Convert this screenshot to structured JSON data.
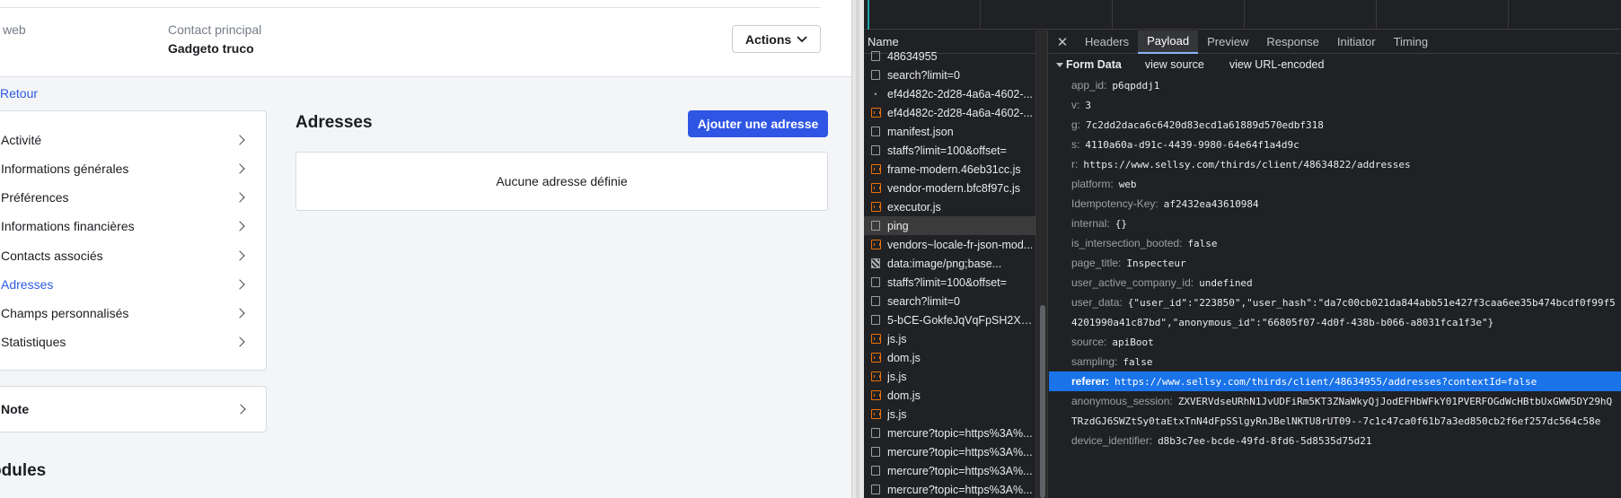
{
  "app": {
    "header": {
      "web_label": "web",
      "contact_label": "Contact principal",
      "contact_value": "Gadgeto truco",
      "actions_label": "Actions"
    },
    "back_label": "Retour",
    "menu": [
      {
        "label": "Activité",
        "active": false
      },
      {
        "label": "Informations générales",
        "active": false
      },
      {
        "label": "Préférences",
        "active": false
      },
      {
        "label": "Informations financières",
        "active": false
      },
      {
        "label": "Contacts associés",
        "active": false
      },
      {
        "label": "Adresses",
        "active": true
      },
      {
        "label": "Champs personnalisés",
        "active": false
      },
      {
        "label": "Statistiques",
        "active": false
      }
    ],
    "note_label": "Note",
    "modules_label": "odules",
    "addresses": {
      "title": "Adresses",
      "add_button": "Ajouter une adresse",
      "empty_text": "Aucune adresse définie"
    },
    "accent_color": "#2f55e4"
  },
  "devtools": {
    "name_header": "Name",
    "requests": [
      {
        "icon": "doc",
        "label": "48634955"
      },
      {
        "icon": "doc",
        "label": "search?limit=0"
      },
      {
        "icon": "dot",
        "label": "ef4d482c-2d28-4a6a-4602-..."
      },
      {
        "icon": "js",
        "label": "ef4d482c-2d28-4a6a-4602-..."
      },
      {
        "icon": "doc",
        "label": "manifest.json"
      },
      {
        "icon": "doc",
        "label": "staffs?limit=100&offset="
      },
      {
        "icon": "js",
        "label": "frame-modern.46eb31cc.js"
      },
      {
        "icon": "js",
        "label": "vendor-modern.bfc8f97c.js"
      },
      {
        "icon": "js",
        "label": "executor.js"
      },
      {
        "icon": "doc",
        "label": "ping",
        "selected": true
      },
      {
        "icon": "js",
        "label": "vendors~locale-fr-json-mod..."
      },
      {
        "icon": "img",
        "label": "data:image/png;base..."
      },
      {
        "icon": "doc",
        "label": "staffs?limit=100&offset="
      },
      {
        "icon": "doc",
        "label": "search?limit=0"
      },
      {
        "icon": "doc",
        "label": "5-bCE-GokfeJqVqFpSH2Xc..."
      },
      {
        "icon": "js",
        "label": "js.js"
      },
      {
        "icon": "js",
        "label": "dom.js"
      },
      {
        "icon": "js",
        "label": "js.js"
      },
      {
        "icon": "js",
        "label": "dom.js"
      },
      {
        "icon": "js",
        "label": "js.js"
      },
      {
        "icon": "doc",
        "label": "mercure?topic=https%3A%..."
      },
      {
        "icon": "doc",
        "label": "mercure?topic=https%3A%..."
      },
      {
        "icon": "doc",
        "label": "mercure?topic=https%3A%..."
      },
      {
        "icon": "doc",
        "label": "mercure?topic=https%3A%..."
      }
    ],
    "tabs": [
      "Headers",
      "Payload",
      "Preview",
      "Response",
      "Initiator",
      "Timing"
    ],
    "active_tab": "Payload",
    "form_data": {
      "title": "Form Data",
      "view_source": "view source",
      "view_url_encoded": "view URL-encoded",
      "rows": [
        {
          "key": "app_id:",
          "value": "p6qpddj1"
        },
        {
          "key": "v:",
          "value": "3"
        },
        {
          "key": "g:",
          "value": "7c2dd2daca6c6420d83ecd1a61889d570edbf318"
        },
        {
          "key": "s:",
          "value": "4110a60a-d91c-4439-9980-64e64f1a4d9c"
        },
        {
          "key": "r:",
          "value": "https://www.sellsy.com/thirds/client/48634822/addresses"
        },
        {
          "key": "platform:",
          "value": "web"
        },
        {
          "key": "Idempotency-Key:",
          "value": "af2432ea43610984"
        },
        {
          "key": "internal:",
          "value": "{}"
        },
        {
          "key": "is_intersection_booted:",
          "value": "false"
        },
        {
          "key": "page_title:",
          "value": "Inspecteur"
        },
        {
          "key": "user_active_company_id:",
          "value": "undefined"
        },
        {
          "key": "user_data:",
          "value": "{\"user_id\":\"223850\",\"user_hash\":\"da7c00cb021da844abb51e427f3caa6ee35b474bcdf0f99f5"
        },
        {
          "key": "",
          "value": "4201990a41c87bd\",\"anonymous_id\":\"66805f07-4d0f-438b-b066-a8031fca1f3e\"}"
        },
        {
          "key": "source:",
          "value": "apiBoot"
        },
        {
          "key": "sampling:",
          "value": "false"
        },
        {
          "key": "referer:",
          "value": "https://www.sellsy.com/thirds/client/48634955/addresses?contextId=false",
          "highlight": true
        },
        {
          "key": "anonymous_session:",
          "value": "ZXVERVdseURhN1JvUDFiRm5KT3ZNaWkyQjJodEFHbWFkY01PVERFOGdWcHBtbUxGWW5DY29hQ"
        },
        {
          "key": "",
          "value": "TRzdGJ6SWZtSy0taEtxTnN4dFpSSlgyRnJBelNKTU8rUT09--7c1c47ca0f61b7a3ed850cb2f6ef257dc564c58e"
        },
        {
          "key": "device_identifier:",
          "value": "d8b3c7ee-bcde-49fd-8fd6-5d8535d75d21"
        }
      ]
    }
  }
}
